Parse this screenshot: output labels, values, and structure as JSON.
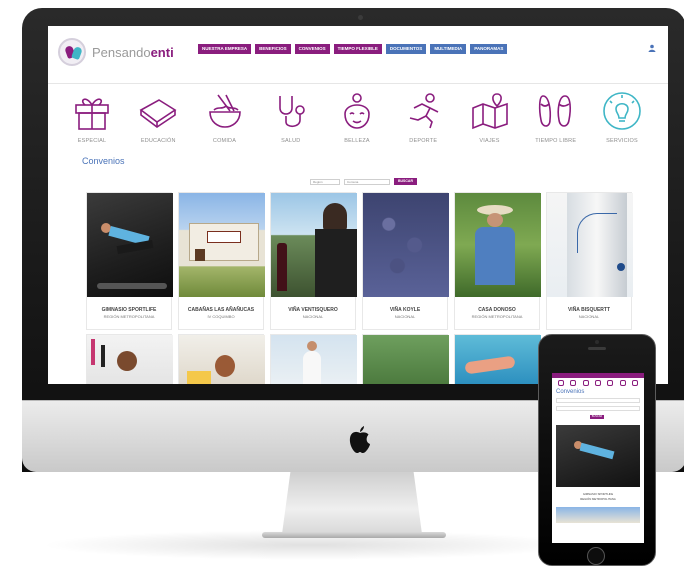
{
  "brand": {
    "name_light": "Pensando",
    "name_bold": "enti",
    "primary_color": "#8a1d7e",
    "secondary_color": "#4a73b8"
  },
  "nav": {
    "items": [
      {
        "label": "NUESTRA EMPRESA"
      },
      {
        "label": "BENEFICIOS"
      },
      {
        "label": "CONVENIOS"
      },
      {
        "label": "TIEMPO FLEXIBLE"
      },
      {
        "label": "DOCUMENTOS"
      },
      {
        "label": "MULTIMEDIA"
      },
      {
        "label": "PANORAMAS"
      }
    ]
  },
  "categories": [
    {
      "label": "ESPECIAL",
      "icon": "gift-icon"
    },
    {
      "label": "EDUCACIÓN",
      "icon": "book-icon"
    },
    {
      "label": "COMIDA",
      "icon": "noodle-bowl-icon"
    },
    {
      "label": "SALUD",
      "icon": "stethoscope-icon"
    },
    {
      "label": "BELLEZA",
      "icon": "face-icon"
    },
    {
      "label": "DEPORTE",
      "icon": "runner-icon"
    },
    {
      "label": "VIAJES",
      "icon": "map-icon"
    },
    {
      "label": "TIEMPO LIBRE",
      "icon": "sandals-icon"
    },
    {
      "label": "SERVICIOS",
      "icon": "lightbulb-icon"
    }
  ],
  "section": {
    "title": "Convenios"
  },
  "filter": {
    "select1": "Región",
    "select2": "Comuna",
    "button": "BUSCAR"
  },
  "cards": [
    {
      "title": "GIMNASIO SPORTLIFE",
      "subtitle": "REGIÓN METROPOLITANA"
    },
    {
      "title": "CABAÑAS LAS AÑAÑUCAS",
      "subtitle": "IV COQUIMBO"
    },
    {
      "title": "VIÑA VENTISQUERO",
      "subtitle": "NACIONAL"
    },
    {
      "title": "VIÑA KOYLE",
      "subtitle": "NACIONAL"
    },
    {
      "title": "CASA DONOSO",
      "subtitle": "REGIÓN METROPOLITANA"
    },
    {
      "title": "VIÑA BISQUERTT",
      "subtitle": "NACIONAL"
    }
  ],
  "phone": {
    "title": "Convenios",
    "button": "BUSCAR",
    "card_title": "GIMNASIO SPORTLIFE",
    "card_sub": "REGIÓN METROPOLITANA"
  }
}
